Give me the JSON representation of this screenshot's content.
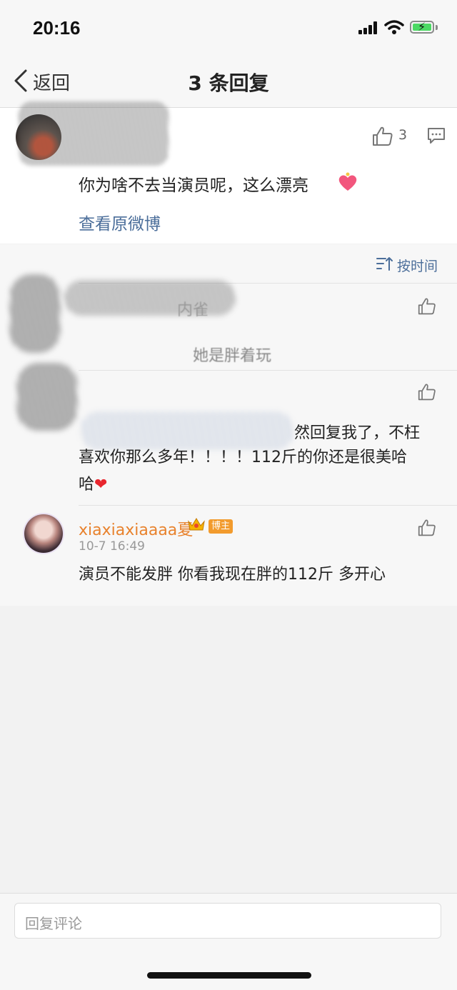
{
  "status_bar": {
    "time": "20:16"
  },
  "nav": {
    "back_label": "返回",
    "title": "3 条回复"
  },
  "main_comment": {
    "like_count": "3",
    "text": "你为啥不去当演员呢，这么漂亮",
    "view_original": "查看原微博"
  },
  "replies": {
    "sort_label": "按时间",
    "reply1": {
      "faded_fragment_a": "内雀",
      "faded_fragment_b": "她是胖着玩"
    },
    "reply2": {
      "visible_line1": "然回复我了，不枉",
      "visible_line2": "喜欢你那么多年！！！！112斤的你还是很美哈",
      "visible_line3": "哈"
    },
    "reply3": {
      "name": "xiaxiaxiaaaa夏",
      "badge": "博主",
      "time": "10-7 16:49",
      "text": "演员不能发胖 你看我现在胖的112斤 多开心"
    }
  },
  "input": {
    "placeholder": "回复评论"
  },
  "colors": {
    "link": "#4b6e9a",
    "username": "#e8822d",
    "badge": "#f29b2d"
  }
}
